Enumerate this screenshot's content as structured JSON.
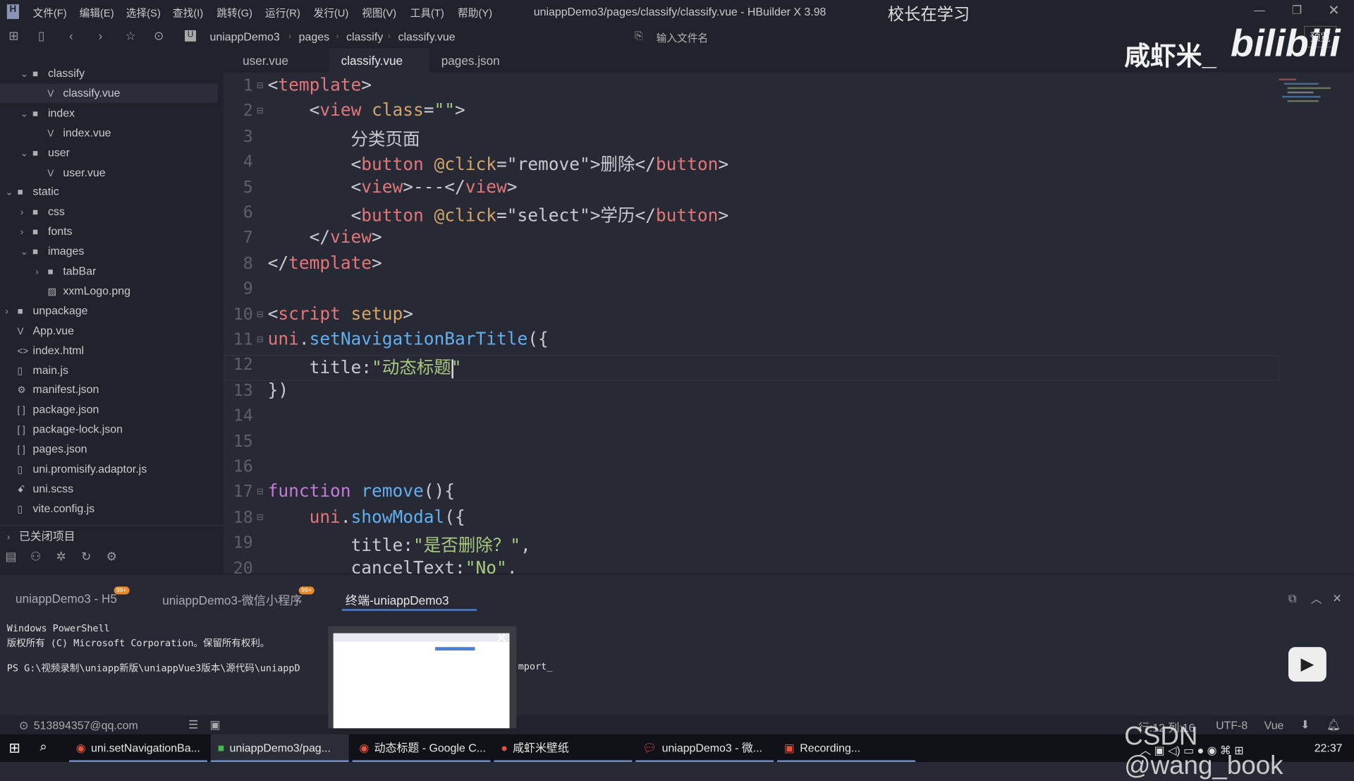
{
  "menu": [
    "文件(F)",
    "编辑(E)",
    "选择(S)",
    "查找(I)",
    "跳转(G)",
    "运行(R)",
    "发行(U)",
    "视图(V)",
    "工具(T)",
    "帮助(Y)"
  ],
  "window_title": "uniappDemo3/pages/classify/classify.vue - HBuilder X 3.98",
  "overlay_title": "校长在学习",
  "breadcrumb": [
    "uniappDemo3",
    "pages",
    "classify",
    "classify.vue"
  ],
  "file_search_placeholder": "输入文件名",
  "preview_label": "预览",
  "watermark": {
    "channel": "咸虾米_",
    "site": "bilibili",
    "csdn": "CSDN @wang_book"
  },
  "tree": [
    {
      "label": "classify",
      "type": "folder",
      "open": true,
      "depth": 2
    },
    {
      "label": "classify.vue",
      "type": "vue",
      "depth": 3,
      "selected": true
    },
    {
      "label": "index",
      "type": "folder",
      "open": true,
      "depth": 2
    },
    {
      "label": "index.vue",
      "type": "vue",
      "depth": 3
    },
    {
      "label": "user",
      "type": "folder",
      "open": true,
      "depth": 2
    },
    {
      "label": "user.vue",
      "type": "vue",
      "depth": 3
    },
    {
      "label": "static",
      "type": "folder",
      "open": true,
      "depth": 1
    },
    {
      "label": "css",
      "type": "folder",
      "open": false,
      "depth": 2
    },
    {
      "label": "fonts",
      "type": "folder",
      "open": false,
      "depth": 2
    },
    {
      "label": "images",
      "type": "folder",
      "open": true,
      "depth": 2
    },
    {
      "label": "tabBar",
      "type": "folder",
      "open": false,
      "depth": 3
    },
    {
      "label": "xxmLogo.png",
      "type": "image",
      "depth": 3
    },
    {
      "label": "unpackage",
      "type": "folder",
      "open": false,
      "depth": 1
    },
    {
      "label": "App.vue",
      "type": "vue",
      "depth": 1
    },
    {
      "label": "index.html",
      "type": "html",
      "depth": 1
    },
    {
      "label": "main.js",
      "type": "file",
      "depth": 1
    },
    {
      "label": "manifest.json",
      "type": "manifest",
      "depth": 1
    },
    {
      "label": "package.json",
      "type": "json",
      "depth": 1
    },
    {
      "label": "package-lock.json",
      "type": "json",
      "depth": 1
    },
    {
      "label": "pages.json",
      "type": "json",
      "depth": 1
    },
    {
      "label": "uni.promisify.adaptor.js",
      "type": "file",
      "depth": 1
    },
    {
      "label": "uni.scss",
      "type": "scss",
      "depth": 1
    },
    {
      "label": "vite.config.js",
      "type": "file",
      "depth": 1
    }
  ],
  "closed_projects": "已关闭项目",
  "editor_tabs": [
    {
      "label": "user.vue"
    },
    {
      "label": "classify.vue",
      "active": true
    },
    {
      "label": "pages.json"
    }
  ],
  "code": [
    [
      [
        "<",
        "t-plain"
      ],
      [
        "template",
        "t-tag"
      ],
      [
        ">",
        "t-plain"
      ]
    ],
    [
      [
        "    <",
        "t-plain"
      ],
      [
        "view",
        "t-tag"
      ],
      [
        " class",
        "t-attr"
      ],
      [
        "=",
        "t-plain"
      ],
      [
        "\"\"",
        "t-str"
      ],
      [
        ">",
        "t-plain"
      ]
    ],
    [
      [
        "        分类页面",
        "t-txt"
      ]
    ],
    [
      [
        "        <",
        "t-plain"
      ],
      [
        "button",
        "t-tag"
      ],
      [
        " @click",
        "t-attr"
      ],
      [
        "=\"remove\">删除</",
        "t-plain"
      ],
      [
        "button",
        "t-tag"
      ],
      [
        ">",
        "t-plain"
      ]
    ],
    [
      [
        "        <",
        "t-plain"
      ],
      [
        "view",
        "t-tag"
      ],
      [
        ">---</",
        "t-plain"
      ],
      [
        "view",
        "t-tag"
      ],
      [
        ">",
        "t-plain"
      ]
    ],
    [
      [
        "        <",
        "t-plain"
      ],
      [
        "button",
        "t-tag"
      ],
      [
        " @click",
        "t-attr"
      ],
      [
        "=\"select\">学历</",
        "t-plain"
      ],
      [
        "button",
        "t-tag"
      ],
      [
        ">",
        "t-plain"
      ]
    ],
    [
      [
        "    </",
        "t-plain"
      ],
      [
        "view",
        "t-tag"
      ],
      [
        ">",
        "t-plain"
      ]
    ],
    [
      [
        "</",
        "t-plain"
      ],
      [
        "template",
        "t-tag"
      ],
      [
        ">",
        "t-plain"
      ]
    ],
    [],
    [
      [
        "<",
        "t-plain"
      ],
      [
        "script",
        "t-tag"
      ],
      [
        " setup",
        "t-attr"
      ],
      [
        ">",
        "t-plain"
      ]
    ],
    [
      [
        "uni",
        "t-obj"
      ],
      [
        ".",
        "t-plain"
      ],
      [
        "setNavigationBarTitle",
        "t-fn"
      ],
      [
        "({",
        "t-plain"
      ]
    ],
    [
      [
        "    title:",
        "t-plain"
      ],
      [
        "\"动态标题\"",
        "t-str"
      ]
    ],
    [
      [
        "})",
        "t-plain"
      ]
    ],
    [],
    [],
    [],
    [
      [
        "function",
        "t-kw"
      ],
      [
        " remove",
        "t-fn"
      ],
      [
        "(){",
        "t-plain"
      ]
    ],
    [
      [
        "    uni",
        "t-obj"
      ],
      [
        ".",
        "t-plain"
      ],
      [
        "showModal",
        "t-fn"
      ],
      [
        "({",
        "t-plain"
      ]
    ],
    [
      [
        "        title:",
        "t-plain"
      ],
      [
        "\"是否删除？\"",
        "t-str"
      ],
      [
        ",",
        "t-plain"
      ]
    ],
    [
      [
        "        cancelText:",
        "t-plain"
      ],
      [
        "\"No\"",
        "t-str"
      ],
      [
        ",",
        "t-plain"
      ]
    ]
  ],
  "panel_tabs": [
    {
      "label": "uniappDemo3 - H5",
      "badge": "99+"
    },
    {
      "label": "uniappDemo3-微信小程序",
      "badge": "99+"
    },
    {
      "label": "终端-uniappDemo3",
      "active": true
    }
  ],
  "terminal": [
    "Windows PowerShell",
    "版权所有 (C) Microsoft Corporation。保留所有权利。",
    "",
    "PS G:\\视频录制\\uniapp新版\\uniappVue3版本\\源代码\\uniappD",
    "mport_"
  ],
  "status": {
    "account": "513894357@qq.com",
    "position": "行:12  列:16",
    "encoding": "UTF-8",
    "language": "Vue"
  },
  "taskbar": [
    {
      "label": "uni.setNavigationBa...",
      "icon": "chrome-icon"
    },
    {
      "label": "uniappDemo3/pag...",
      "icon": "hbuilder-icon",
      "active": true
    },
    {
      "label": "动态标题 - Google C...",
      "icon": "chrome-icon"
    },
    {
      "label": "咸虾米壁纸",
      "icon": "app-icon"
    },
    {
      "label": "uniappDemo3 - 微...",
      "icon": "wechat-icon"
    },
    {
      "label": "Recording...",
      "icon": "recording-icon"
    }
  ],
  "clock": "22:37"
}
